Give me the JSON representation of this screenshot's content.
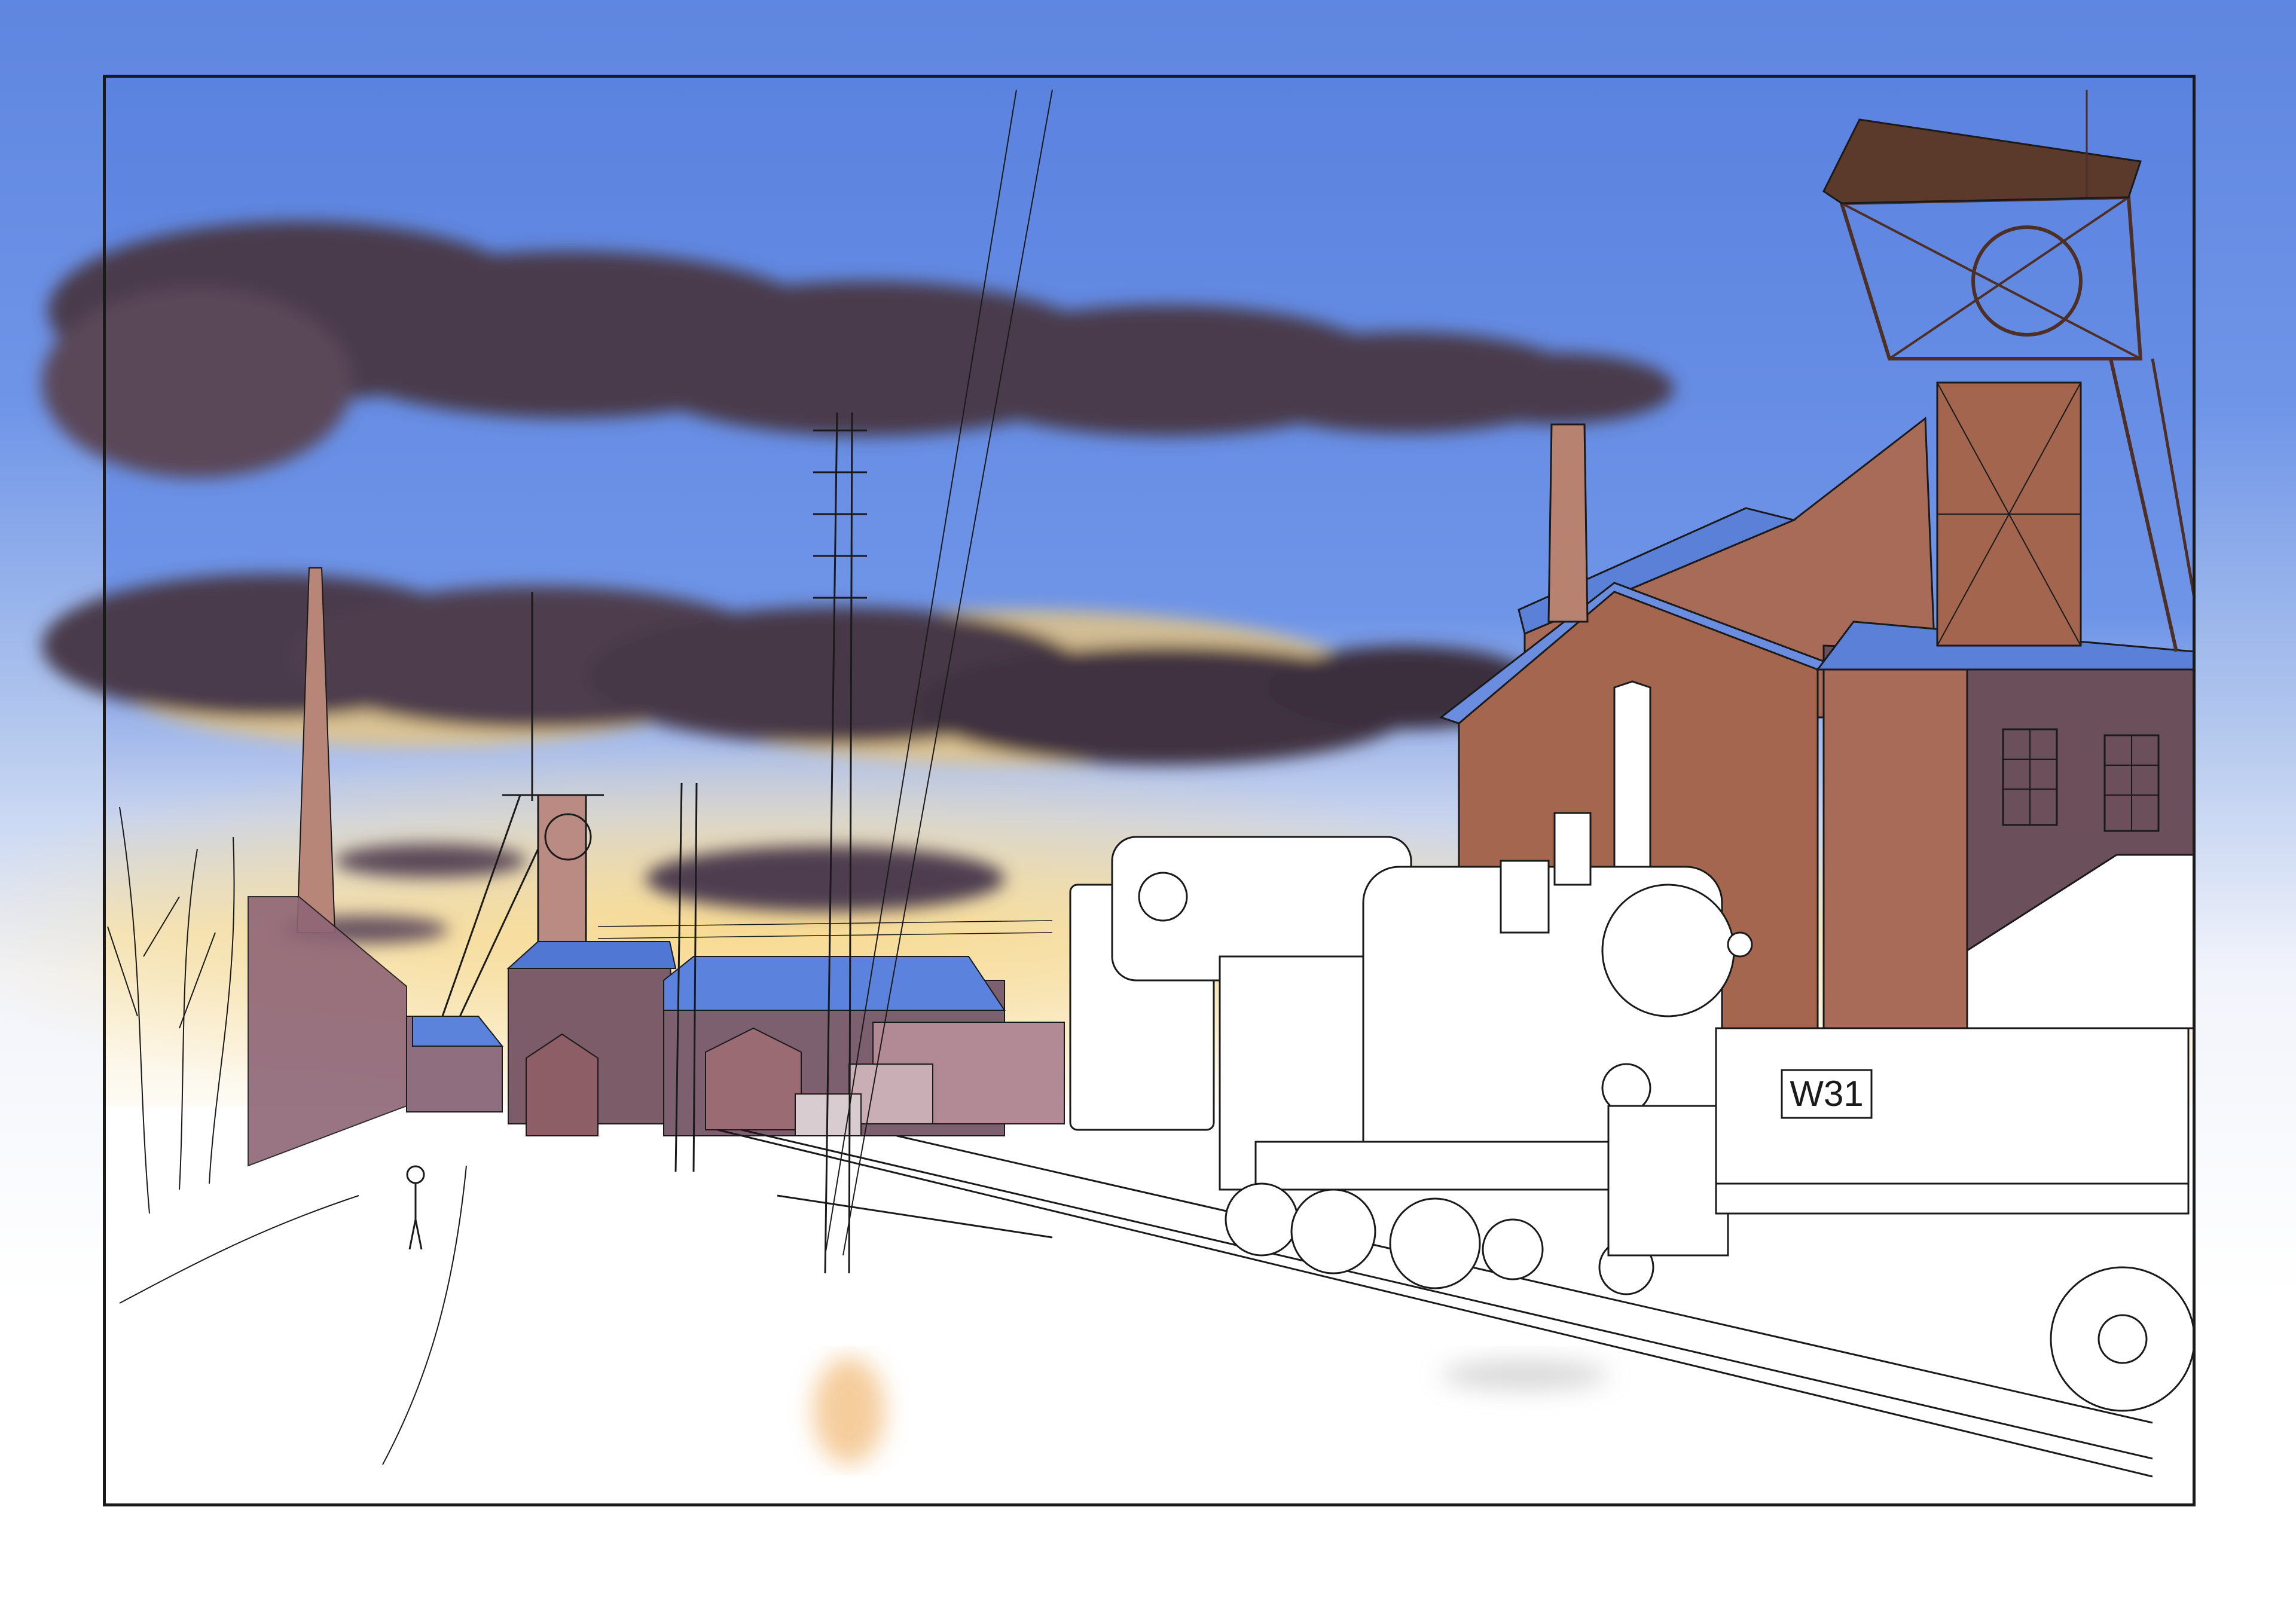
{
  "artwork": {
    "wagon_plate": "W31"
  },
  "colors": {
    "sky_top": "#5f86e0",
    "sky_mid": "#6d91e6",
    "horizon_glow": "#f6dfa4",
    "smoke": "#4a3a4c",
    "smoke_dark": "#382a3a",
    "brick": "#a46652",
    "brick_shadow": "#6b4f5a",
    "roof_blue": "#5579d6",
    "steel": "#4e2f25",
    "ink": "#1a1a1a",
    "paper": "#ffffff"
  },
  "icons": [
    "headframe-tower",
    "chimney",
    "steam-locomotive",
    "coal-wagon",
    "smoke-plume",
    "telegraph-pole",
    "walking-figure"
  ]
}
